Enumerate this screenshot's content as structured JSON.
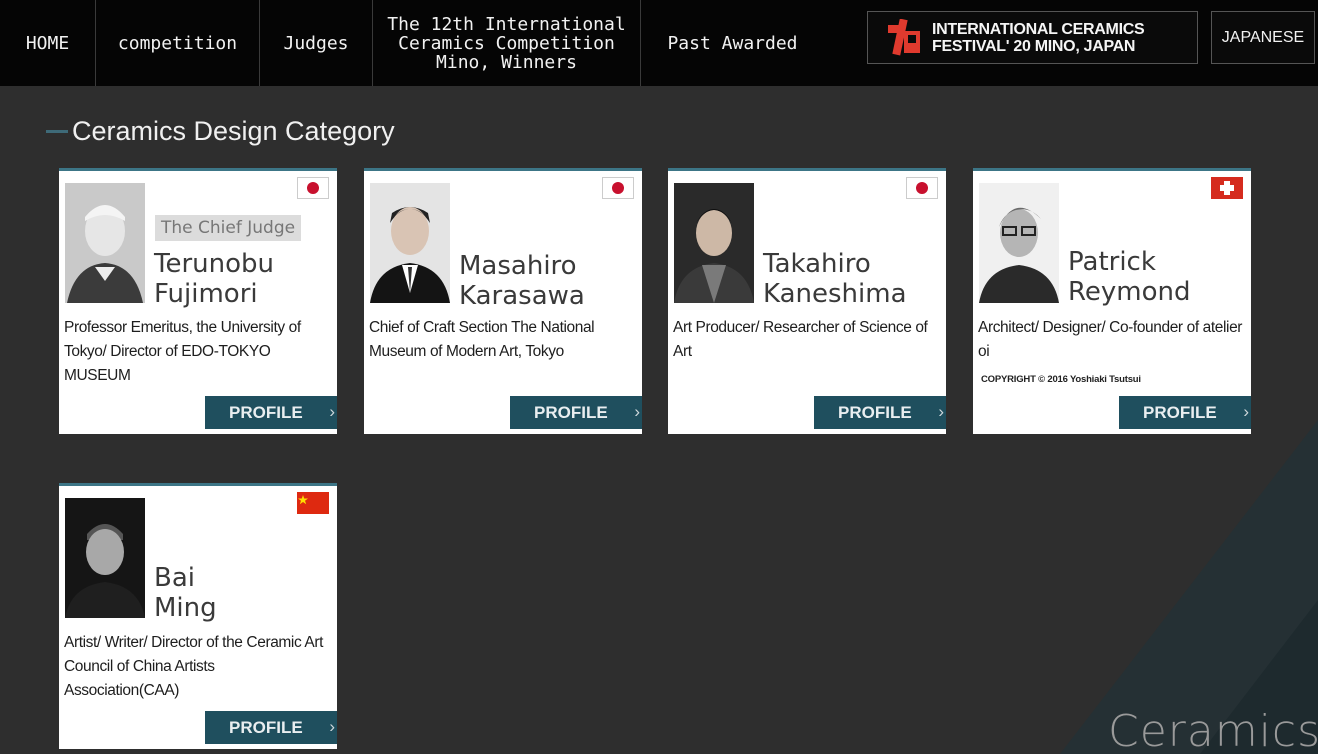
{
  "nav": {
    "home": "HOME",
    "competition": "competition",
    "judges": "Judges",
    "winners_line1": "The 12th International",
    "winners_line2": "Ceramics Competition",
    "winners_line3": "Mino, Winners",
    "past": "Past Awarded"
  },
  "logo": {
    "line1": "INTERNATIONAL CERAMICS",
    "line2": "FESTIVAL' 20 MINO, JAPAN",
    "mark_color": "#e03a2e"
  },
  "language_button": "JAPANESE",
  "section_title": "Ceramics Design Category",
  "profile_label": "PROFILE",
  "chief_label": "The Chief Judge",
  "judges": [
    {
      "first": "Terunobu",
      "last": "Fujimori",
      "flag": "japan",
      "desc": "Professor Emeritus, the University of Tokyo/ Director of EDO-TOKYO MUSEUM"
    },
    {
      "first": "Masahiro",
      "last": "Karasawa",
      "flag": "japan",
      "desc": "Chief of Craft Section The National Museum of Modern Art, Tokyo"
    },
    {
      "first": "Takahiro",
      "last": "Kaneshima",
      "flag": "japan",
      "desc": "Art Producer/ Researcher of Science of Art"
    },
    {
      "first": "Patrick",
      "last": "Reymond",
      "flag": "switzerland",
      "desc": "Architect/ Designer/ Co-founder of atelier oi",
      "copyright": "COPYRIGHT © 2016 Yoshiaki Tsutsui"
    },
    {
      "first": "Bai",
      "last": "Ming",
      "flag": "china",
      "desc": "Artist/ Writer/ Director of the Ceramic Art Council of China Artists Association(CAA)"
    }
  ],
  "watermark": "Ceramics",
  "colors": {
    "background": "#2e2e2e",
    "nav": "#050505",
    "button": "#1f4f5e",
    "card_border": "#3c7586"
  }
}
